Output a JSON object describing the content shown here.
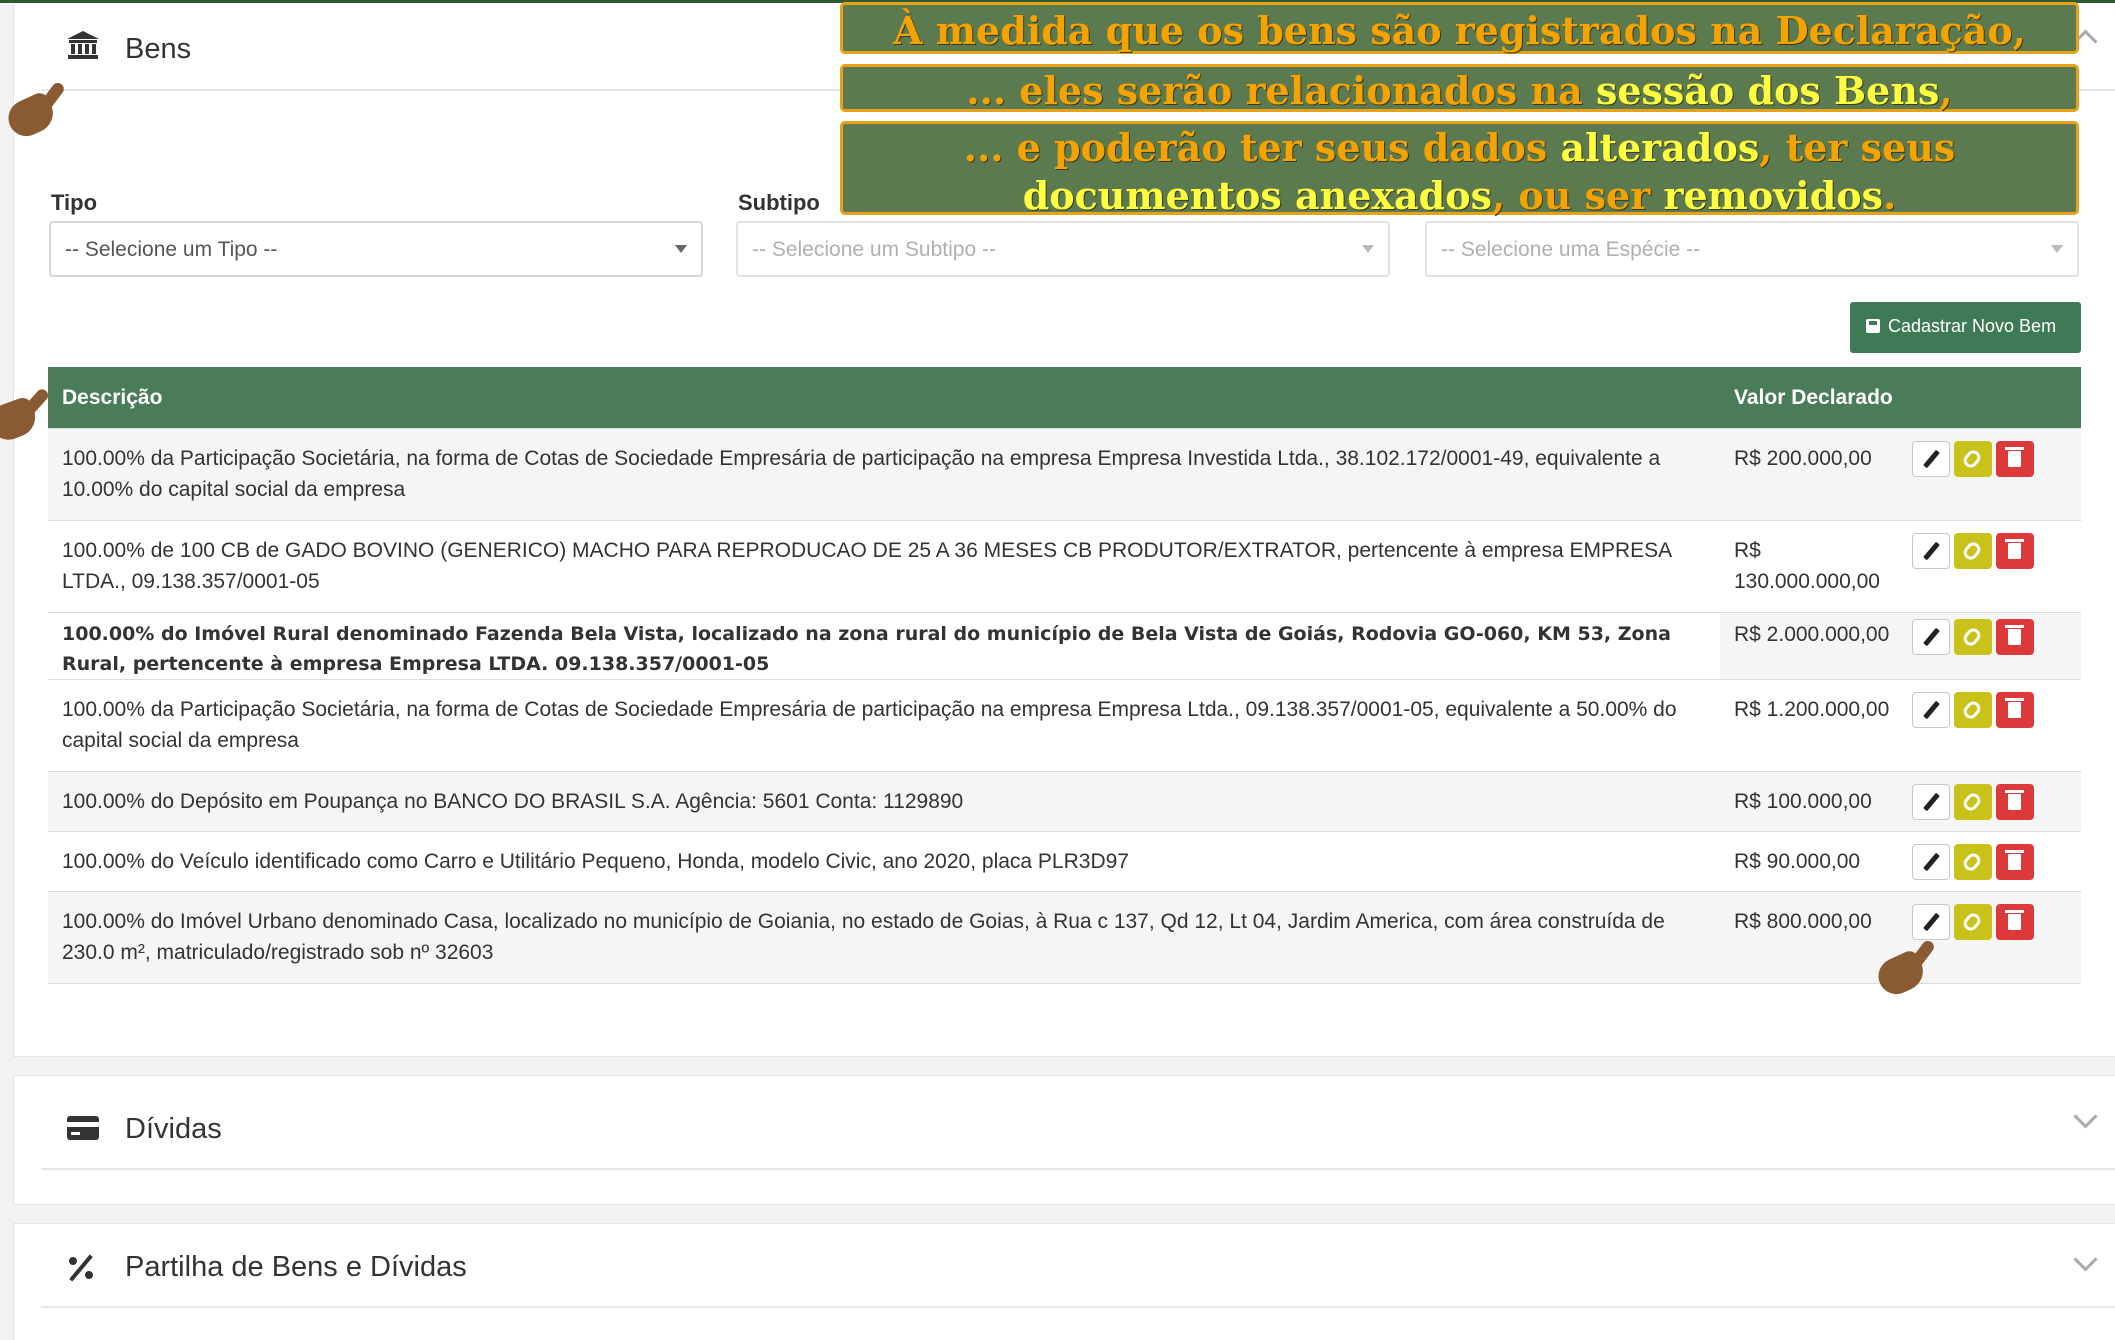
{
  "overlay": {
    "line1": "À medida que os bens são registrados na Declaração,",
    "line2_pre": "... eles serão relacionados na ",
    "line2_hl": "sessão dos Bens",
    "line2_post": ",",
    "line3_pre": "... e poderão ter seus dados ",
    "line3_hl1": "alterados",
    "line3_mid": ", ter seus",
    "line4_hl": "documentos anexados",
    "line4_mid": ", ou ser ",
    "line4_hl2": "removidos",
    "line4_end": "."
  },
  "bens": {
    "title": "Bens",
    "icon": "bank-icon",
    "tipo_label": "Tipo",
    "subtipo_label": "Subtipo",
    "tipo_value": "-- Selecione um Tipo --",
    "subtipo_value": "-- Selecione um Subtipo --",
    "especie_value": "-- Selecione uma Espécie --",
    "new_button": "Cadastrar Novo Bem",
    "table": {
      "headers": [
        "Descrição",
        "Valor Declarado"
      ],
      "rows": [
        {
          "desc": "100.00% da Participação Societária, na forma de Cotas de Sociedade Empresária de participação na empresa Empresa Investida Ltda., 38.102.172/0001-49, equivalente a 10.00% do capital social da empresa",
          "valor": "R$ 200.000,00"
        },
        {
          "desc": "100.00% de 100 CB de GADO BOVINO (GENERICO) MACHO PARA REPRODUCAO DE 25 A 36 MESES CB PRODUTOR/EXTRATOR, pertencente à empresa EMPRESA LTDA., 09.138.357/0001-05",
          "valor": "R$ 130.000.000,00"
        },
        {
          "desc": "100.00% do Imóvel Rural denominado Fazenda Bela Vista, localizado na zona rural do município de Bela Vista de Goiás, Rodovia GO-060, KM 53, Zona Rural, pertencente à empresa Empresa LTDA.  09.138.357/0001-05",
          "valor": "R$ 2.000.000,00"
        },
        {
          "desc": "100.00% da Participação Societária, na forma de Cotas de Sociedade Empresária de participação na empresa Empresa Ltda., 09.138.357/0001-05, equivalente a 50.00% do capital social da empresa",
          "valor": "R$ 1.200.000,00"
        },
        {
          "desc": "100.00% do Depósito em Poupança no BANCO DO BRASIL S.A. Agência: 5601 Conta: 1129890",
          "valor": "R$ 100.000,00"
        },
        {
          "desc": "100.00% do Veículo identificado como Carro e Utilitário Pequeno, Honda, modelo Civic, ano 2020, placa PLR3D97",
          "valor": "R$ 90.000,00"
        },
        {
          "desc": "100.00% do Imóvel Urbano denominado Casa, localizado no município de Goiania, no estado de Goias, à Rua c 137, Qd 12, Lt 04, Jardim America, com área construída de 230.0 m², matriculado/registrado sob nº 32603",
          "valor": "R$ 800.000,00"
        }
      ]
    }
  },
  "dividas": {
    "title": "Dívidas",
    "icon": "credit-card-icon"
  },
  "partilha": {
    "title": "Partilha de Bens e Dívidas",
    "icon": "percent-icon"
  },
  "colors": {
    "header_green": "#4b7c59",
    "overlay_bg": "#5b7a50",
    "overlay_text": "#f5a300",
    "highlight": "#ffff40",
    "attach": "#c9c21a",
    "delete": "#dc3a3a"
  }
}
